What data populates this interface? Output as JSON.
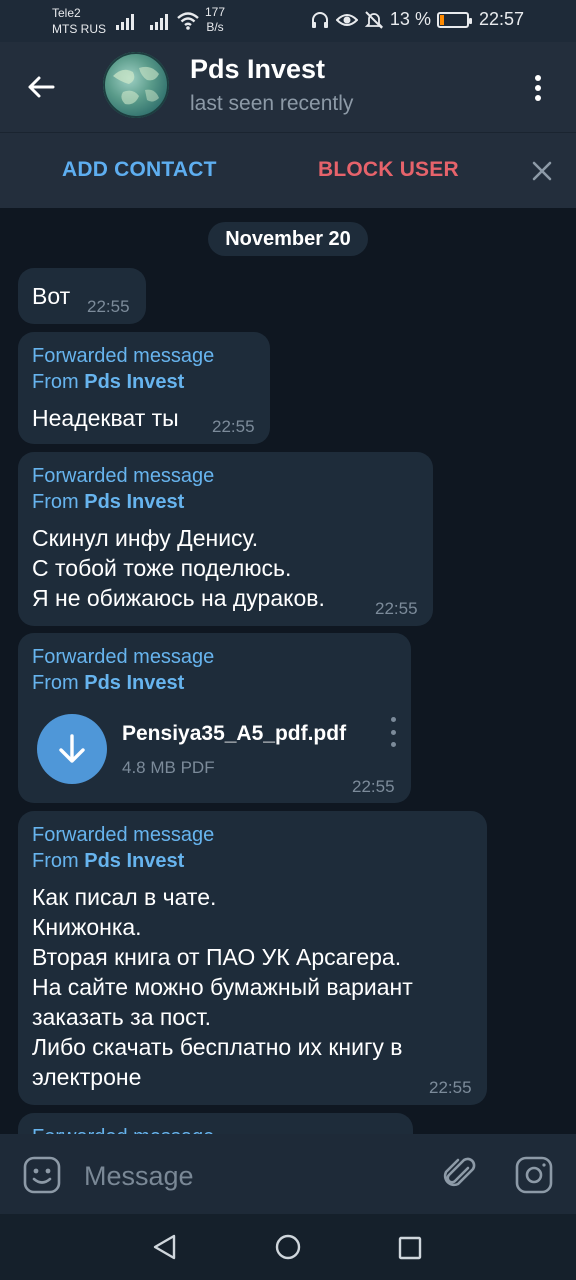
{
  "status_bar": {
    "carrier_1": "Tele2",
    "carrier_2": "MTS RUS",
    "net_speed_value": "177",
    "net_speed_unit": "B/s",
    "battery": "13 %",
    "time": "22:57"
  },
  "header": {
    "title": "Pds Invest",
    "subtitle": "last seen recently"
  },
  "actions": {
    "add_contact": "ADD CONTACT",
    "block_user": "BLOCK USER"
  },
  "chat": {
    "date": "November 20",
    "messages": [
      {
        "text": "Вот",
        "time": "22:55"
      },
      {
        "forward_label": "Forwarded message",
        "from_prefix": "From",
        "from_name": "Pds Invest",
        "text": "Неадекват ты",
        "time": "22:55"
      },
      {
        "forward_label": "Forwarded message",
        "from_prefix": "From",
        "from_name": "Pds Invest",
        "text": "Скинул инфу  Денису.\nС тобой тоже поделюсь.\nЯ не обижаюсь на дураков.",
        "time": "22:55"
      },
      {
        "forward_label": "Forwarded message",
        "from_prefix": "From",
        "from_name": "Pds Invest",
        "file_name": "Pensiya35_A5_pdf.pdf",
        "file_size": "4.8 MB PDF",
        "time": "22:55"
      },
      {
        "forward_label": "Forwarded message",
        "from_prefix": "From",
        "from_name": "Pds Invest",
        "text": "Как писал в чате.\nКнижонка.\nВторая книга от ПАО УК Арсагера.\nНа сайте можно бумажный вариант заказать за пост.\nЛибо скачать бесплатно их книгу в электроне",
        "time": "22:55"
      },
      {
        "forward_label": "Forwarded message"
      }
    ]
  },
  "composer": {
    "placeholder": "Message"
  },
  "colors": {
    "accent": "#5eaef0",
    "danger": "#e6636b",
    "bubble": "#1e2c3a",
    "background": "#0f1721"
  },
  "icons": {
    "back": "arrow-left-icon",
    "menu": "more-vertical-icon",
    "close": "close-icon",
    "download": "arrow-down-icon",
    "emoji": "emoji-icon",
    "attach": "paperclip-icon",
    "camera": "camera-icon"
  }
}
